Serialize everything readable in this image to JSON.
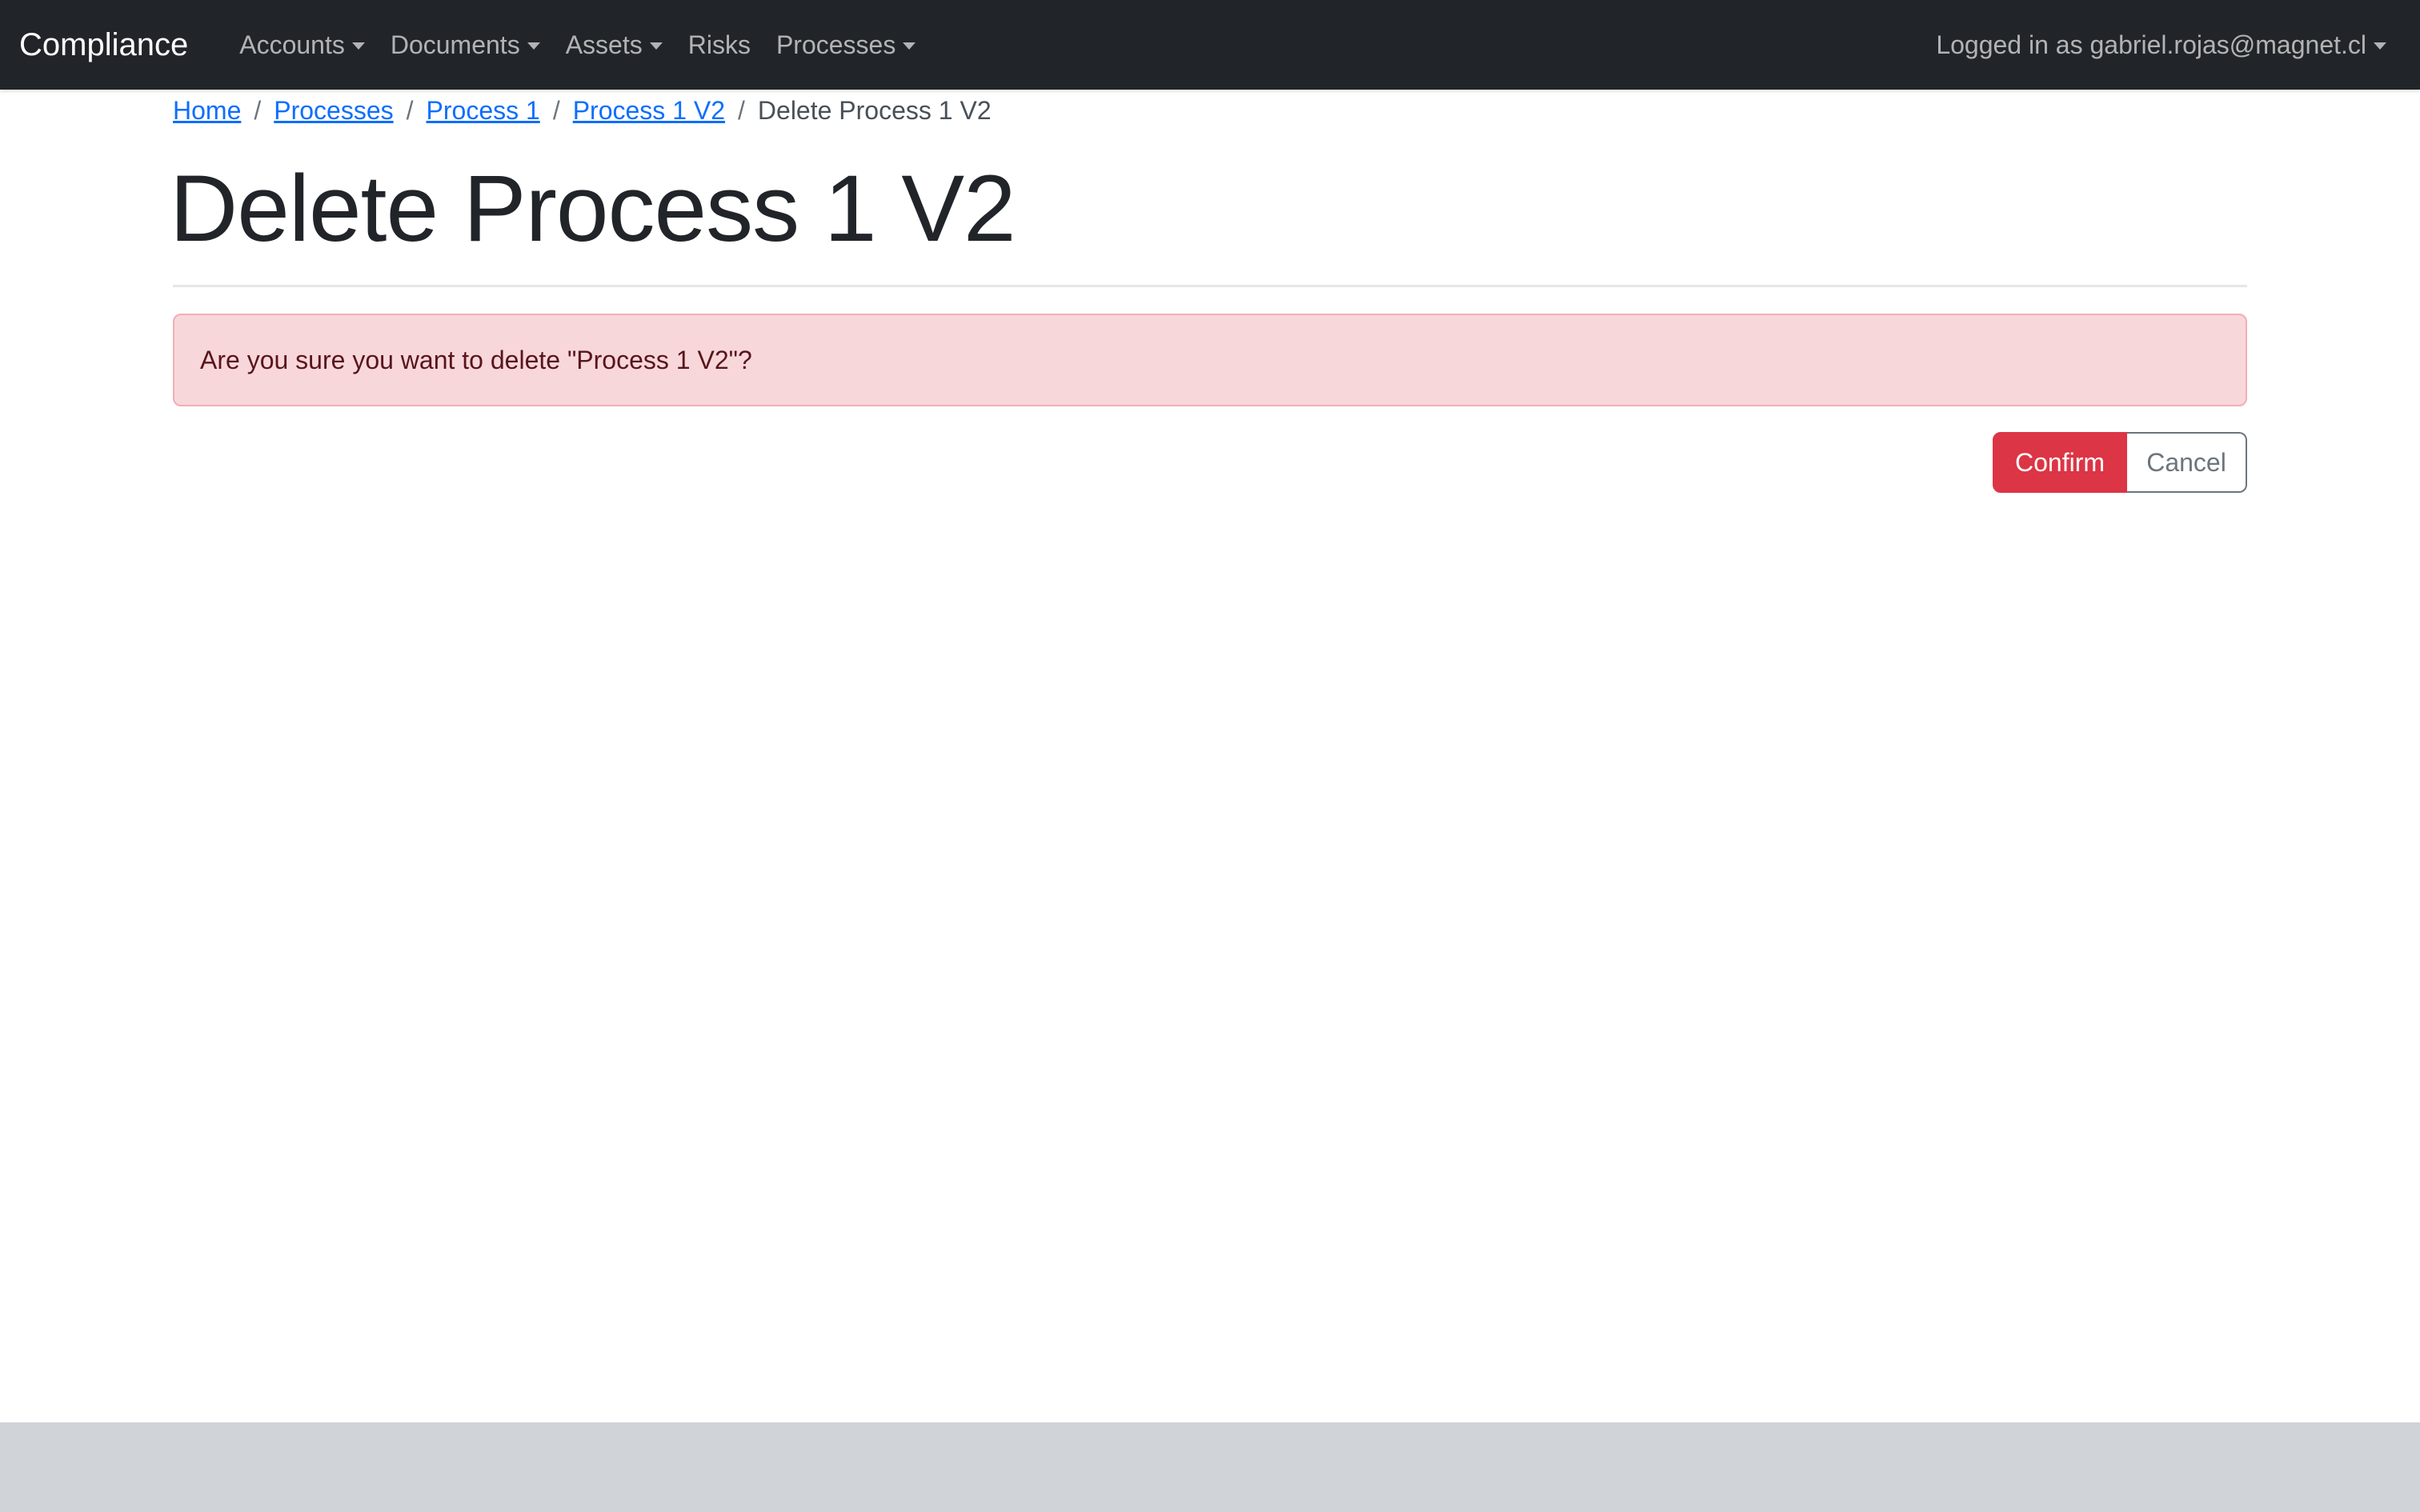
{
  "navbar": {
    "brand": "Compliance",
    "items": [
      {
        "label": "Accounts",
        "dropdown": true
      },
      {
        "label": "Documents",
        "dropdown": true
      },
      {
        "label": "Assets",
        "dropdown": true
      },
      {
        "label": "Risks",
        "dropdown": false
      },
      {
        "label": "Processes",
        "dropdown": true
      }
    ],
    "user_label": "Logged in as gabriel.rojas@magnet.cl"
  },
  "breadcrumb": {
    "items": [
      "Home",
      "Processes",
      "Process 1",
      "Process 1 V2"
    ],
    "active": "Delete Process 1 V2",
    "separator": "/"
  },
  "page": {
    "title": "Delete Process 1 V2",
    "alert_message": "Are you sure you want to delete \"Process 1 V2\"?"
  },
  "actions": {
    "confirm_label": "Confirm",
    "cancel_label": "Cancel"
  },
  "colors": {
    "navbar_bg": "#212529",
    "danger": "#dc3545",
    "alert_bg": "#f8d7da",
    "link": "#0d6efd",
    "footer_bg": "#d0d4d8"
  }
}
